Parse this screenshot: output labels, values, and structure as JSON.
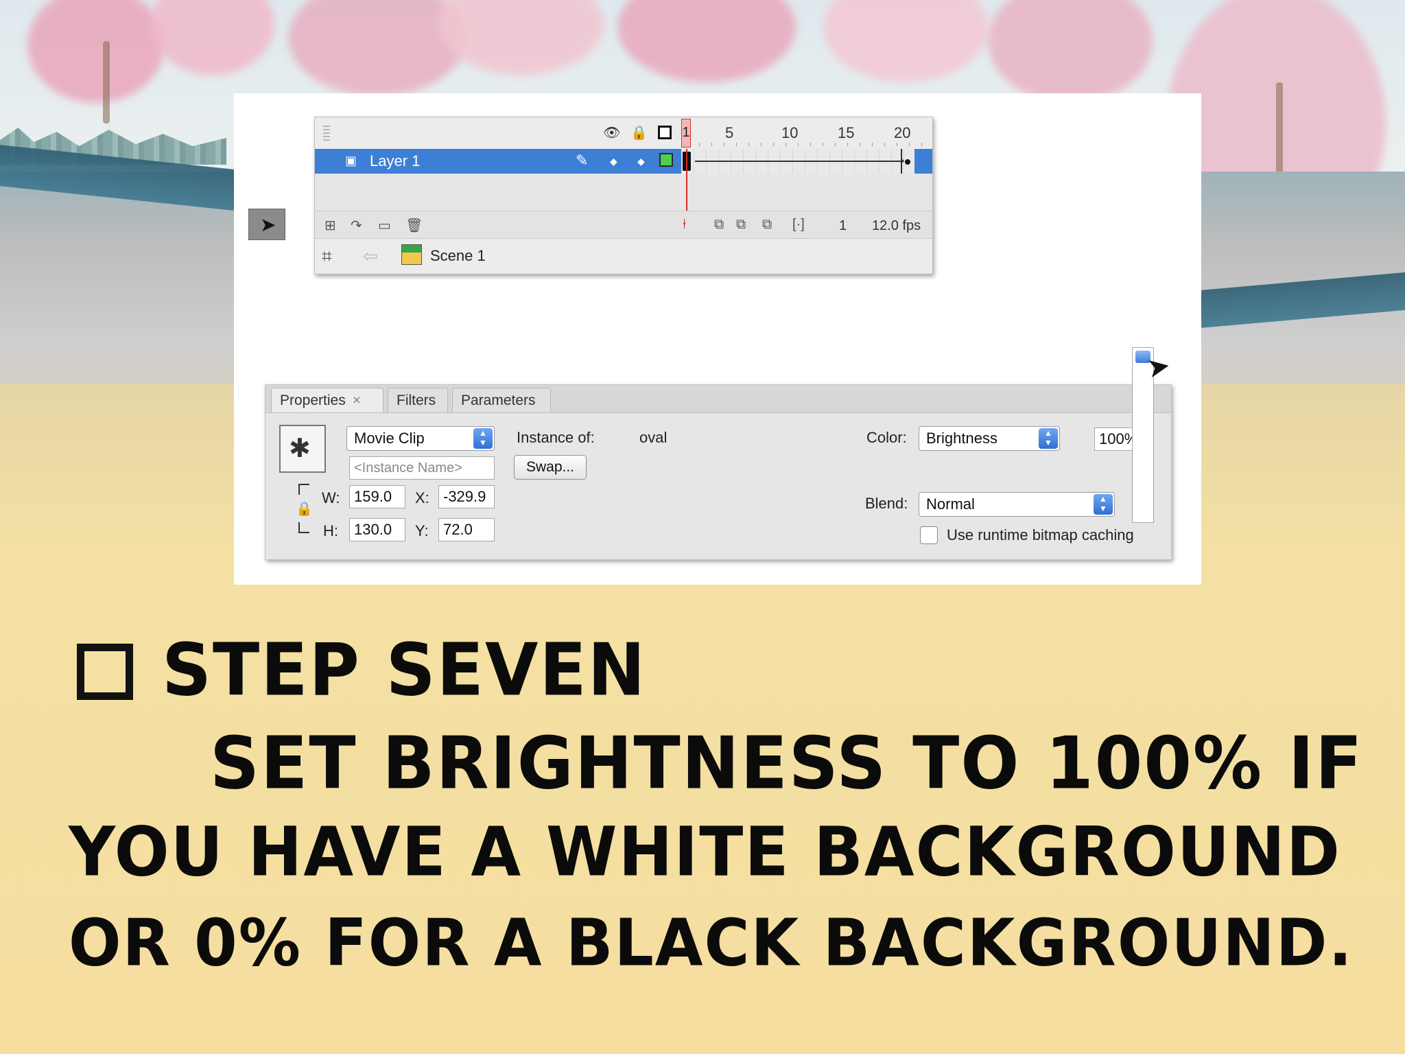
{
  "timeline": {
    "layer_name": "Layer 1",
    "ruler_numbers": [
      "1",
      "5",
      "10",
      "15",
      "20"
    ],
    "current_frame": "1",
    "fps": "12.0 fps",
    "scene_name": "Scene 1"
  },
  "properties": {
    "tabs": [
      {
        "label": "Properties"
      },
      {
        "label": "Filters"
      },
      {
        "label": "Parameters"
      }
    ],
    "symbol_type": "Movie Clip",
    "instance_of_label": "Instance of:",
    "instance_of_value": "oval",
    "instance_name_placeholder": "<Instance Name>",
    "swap_label": "Swap...",
    "w_label": "W:",
    "w_value": "159.0",
    "h_label": "H:",
    "h_value": "130.0",
    "x_label": "X:",
    "x_value": "-329.9",
    "y_label": "Y:",
    "y_value": "72.0",
    "color_label": "Color:",
    "color_value": "Brightness",
    "color_amount": "100%",
    "blend_label": "Blend:",
    "blend_value": "Normal",
    "bitmap_caching_label": "Use runtime bitmap caching"
  },
  "caption": {
    "heading": "Step Seven",
    "line1": "Set Brightness to 100% if",
    "line2": "you have a white background",
    "line3": "or 0% for a black background."
  },
  "colors": {
    "layer_highlight": "#3e7fd6",
    "playhead": "#d62a2a",
    "keyframe_green": "#4ed04e",
    "ground": "#f5dea0"
  },
  "icons": [
    "eye-icon",
    "lock-icon",
    "outline-icon",
    "pencil-icon",
    "arrow-tool-icon",
    "edit-scene-icon",
    "clapperboard-icon",
    "movie-clip-icon"
  ]
}
